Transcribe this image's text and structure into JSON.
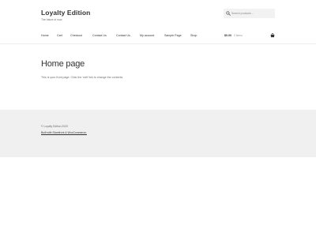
{
  "header": {
    "site_title": "Loyalty Edition",
    "tagline": "The future of now",
    "search": {
      "placeholder": "Search products…",
      "icon": "search-icon"
    }
  },
  "nav": {
    "items": [
      {
        "label": "Home"
      },
      {
        "label": "Cart"
      },
      {
        "label": "Checkout"
      },
      {
        "label": "Contact Us"
      },
      {
        "label": "Contact Us"
      },
      {
        "label": "My account"
      },
      {
        "label": "Sample Page"
      },
      {
        "label": "Shop"
      }
    ],
    "cart": {
      "amount": "$0.00",
      "count": "0 items",
      "icon": "cart-icon"
    }
  },
  "main": {
    "title": "Home page",
    "body": "This is your front page. Click the 'edit' link to change the contents"
  },
  "footer": {
    "copyright": "© Loyalty Edition 2020",
    "credit_link": "Built with Storefront & WooCommerce."
  },
  "colors": {
    "footer_bg": "#f0f0f0",
    "search_bg": "#f2f2f2",
    "text_dark": "#333333",
    "text_muted": "#6d6d6d"
  }
}
